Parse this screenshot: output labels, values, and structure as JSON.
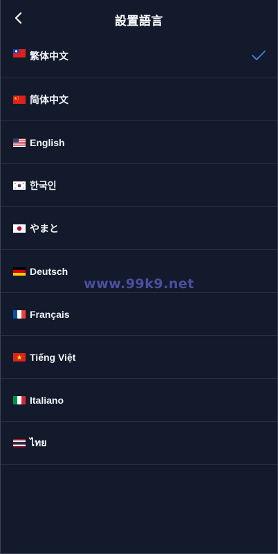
{
  "header": {
    "title": "設置語言",
    "back_icon": "chevron-left-icon"
  },
  "languages": [
    {
      "label": "繁体中文",
      "flag": "taiwan-flag-icon",
      "selected": true
    },
    {
      "label": "简体中文",
      "flag": "china-flag-icon",
      "selected": false
    },
    {
      "label": "English",
      "flag": "usa-flag-icon",
      "selected": false
    },
    {
      "label": "한국인",
      "flag": "korea-flag-icon",
      "selected": false
    },
    {
      "label": "やまと",
      "flag": "japan-flag-icon",
      "selected": false
    },
    {
      "label": "Deutsch",
      "flag": "germany-flag-icon",
      "selected": false
    },
    {
      "label": "Français",
      "flag": "france-flag-icon",
      "selected": false
    },
    {
      "label": "Tiếng Việt",
      "flag": "vietnam-flag-icon",
      "selected": false
    },
    {
      "label": "Italiano",
      "flag": "italy-flag-icon",
      "selected": false
    },
    {
      "label": "ไทย",
      "flag": "thailand-flag-icon",
      "selected": false
    }
  ],
  "watermark": "www.99k9.net",
  "colors": {
    "background": "#131a2b",
    "divider": "#26304a",
    "check": "#3d8ff0",
    "watermark": "#4a4f9e"
  }
}
